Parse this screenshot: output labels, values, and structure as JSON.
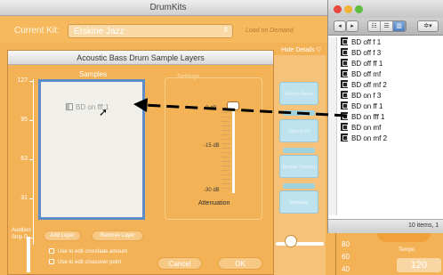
{
  "drumkits": {
    "title": "DrumKits",
    "current_kit_label": "Current Kit:",
    "current_kit_value": "Erskine Jazz",
    "load_on_demand": "Load on Demand",
    "hide_details": "Hide Details ▽",
    "side_buttons": [
      "Velocity Zones",
      "Open in Kit",
      "Browse Content",
      "Metadata"
    ]
  },
  "sample_layers": {
    "title": "Acoustic Bass Drum Sample Layers",
    "samples_label": "Samples",
    "settings_label": "Settings",
    "axis_labels": [
      "127",
      "95",
      "63",
      "31",
      "0"
    ],
    "sample_item": "BD on fff 1",
    "db_labels": [
      "0 dB",
      "-15 dB",
      "-30 dB"
    ],
    "attenuation_label": "Attenuation",
    "audition_strip_label": "Audition Strip",
    "add_layer_label": "Add Layer",
    "remove_layer_label": "Remove Layer",
    "check_crossfade": "Use to edit crossfade amount",
    "check_crossover": "Use to edit crossover point",
    "cancel_label": "Cancel",
    "ok_label": "OK"
  },
  "finder": {
    "nav_back": "◂",
    "nav_forward": "▸",
    "view_buttons": [
      "☷",
      "☰",
      "▥"
    ],
    "action_button": "✲▾",
    "files": [
      "BD off f 1",
      "BD off f 3",
      "BD off ff 1",
      "BD off mf",
      "BD off mf 2",
      "BD on f 3",
      "BD on ff 1",
      "BD on fff 1",
      "BD on mf",
      "BD on mf 2"
    ],
    "status": "10 items, 1"
  },
  "meters": {
    "scale": [
      "80",
      "60",
      "40"
    ],
    "tempo_label": "Tempo",
    "tempo_value": "120"
  },
  "colors": {
    "dialog_bg": "#f3b256",
    "selection_border": "#5d8cc8",
    "side_button": "#bfe3ee"
  }
}
